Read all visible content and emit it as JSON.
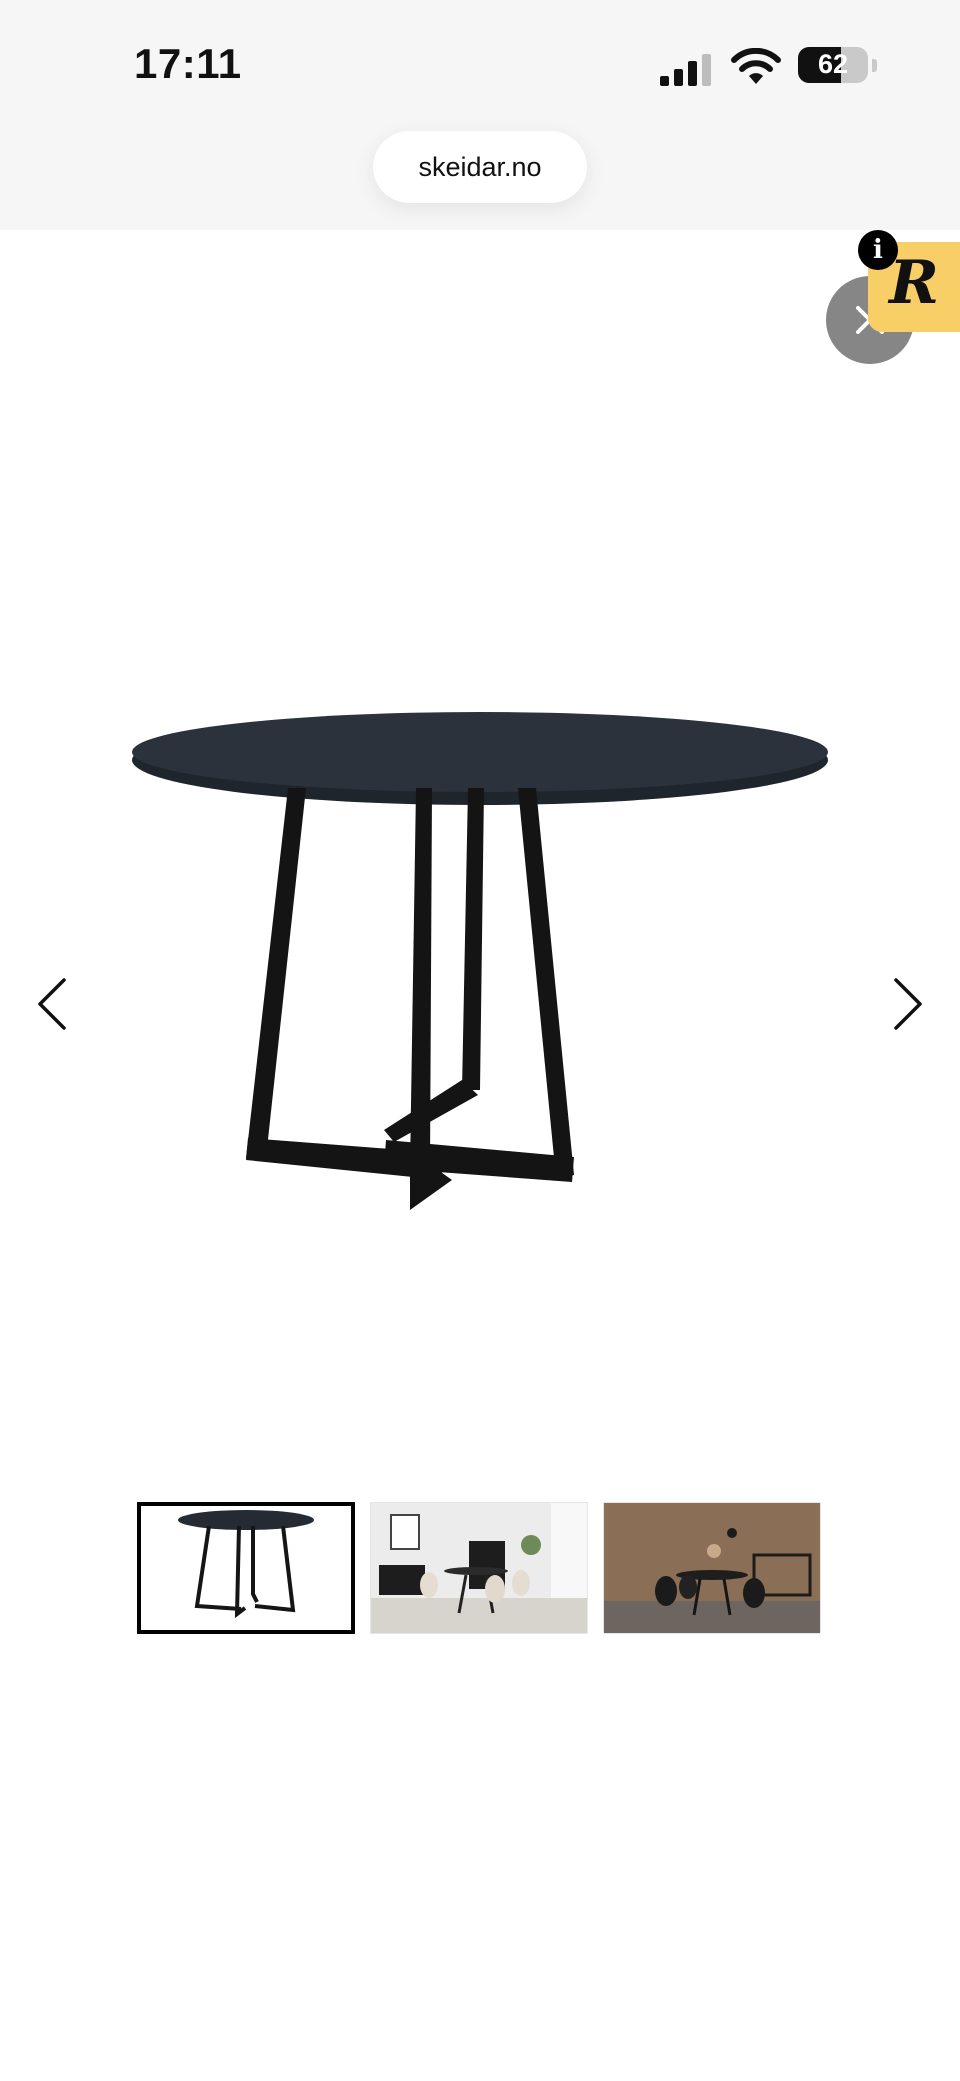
{
  "status_bar": {
    "time": "17:11",
    "battery_level": "62"
  },
  "browser": {
    "url": "skeidar.no"
  },
  "overlay": {
    "info_label": "i",
    "badge_letter": "R",
    "badge_color": "#f7cf66"
  },
  "gallery": {
    "current_index": 1,
    "thumbnails": [
      {
        "index": 1,
        "active": true
      },
      {
        "index": 2,
        "active": false
      },
      {
        "index": 3,
        "active": false
      }
    ]
  },
  "icons": [
    "signal-icon",
    "wifi-icon",
    "battery-icon",
    "close-icon",
    "chevron-left-icon",
    "chevron-right-icon",
    "info-icon"
  ]
}
